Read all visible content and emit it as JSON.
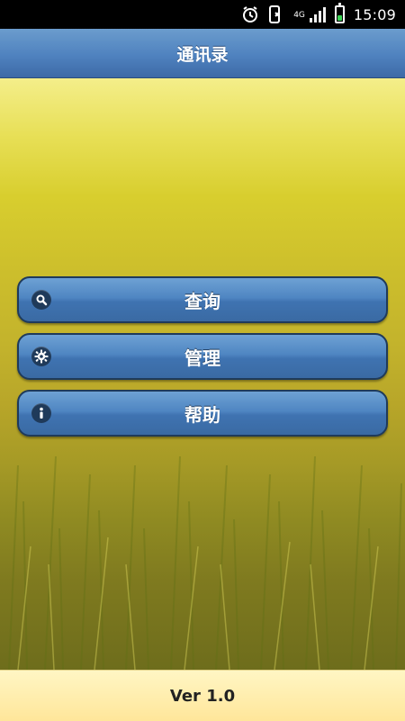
{
  "status_bar": {
    "time": "15:09",
    "network_label": "4G",
    "alarm_icon": "alarm-clock-icon",
    "nfc_icon": "phone-nfc-icon",
    "signal_icon": "signal-icon",
    "battery_icon": "battery-icon"
  },
  "header": {
    "title": "通讯录"
  },
  "menu": {
    "items": [
      {
        "label": "查询",
        "icon": "search-icon"
      },
      {
        "label": "管理",
        "icon": "gear-icon"
      },
      {
        "label": "帮助",
        "icon": "info-icon"
      }
    ]
  },
  "footer": {
    "version": "Ver 1.0"
  },
  "colors": {
    "header_blue": "#4f82bf",
    "button_blue": "#4f86c2",
    "footer_yellow": "#fff0b0"
  }
}
